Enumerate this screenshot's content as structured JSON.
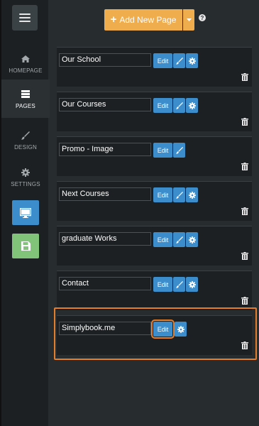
{
  "sidebar": {
    "items": [
      {
        "label": "HOMEPAGE",
        "icon": "home-icon"
      },
      {
        "label": "PAGES",
        "icon": "pages-icon",
        "active": true
      },
      {
        "label": "DESIGN",
        "icon": "brush-icon"
      },
      {
        "label": "SETTINGS",
        "icon": "gear-icon"
      }
    ],
    "preview_icon": "monitor-icon",
    "save_icon": "floppy-disk-icon"
  },
  "toolbar": {
    "add_label": "Add New Page",
    "help_label": "?"
  },
  "pages": [
    {
      "name": "Our School",
      "edit": "Edit"
    },
    {
      "name": "Our Courses",
      "edit": "Edit"
    },
    {
      "name": "Promo - Image",
      "edit": "Edit"
    },
    {
      "name": "Next Courses",
      "edit": "Edit"
    },
    {
      "name": "graduate Works",
      "edit": "Edit"
    },
    {
      "name": "Contact",
      "edit": "Edit"
    },
    {
      "name": "Simplybook.me",
      "edit": "Edit",
      "highlighted": true
    }
  ],
  "colors": {
    "accent": "#f0ad4e",
    "primary": "#3c8dcb",
    "highlight": "#e47e2b",
    "save": "#82c37a"
  }
}
